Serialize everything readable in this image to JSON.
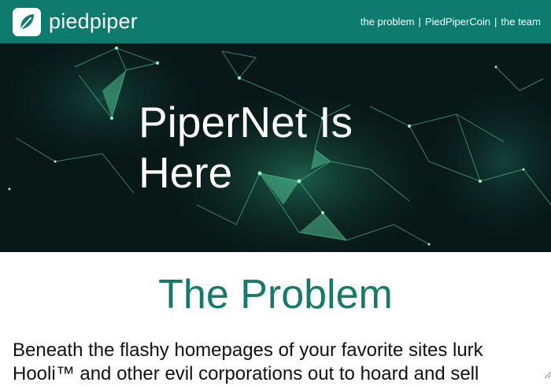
{
  "header": {
    "brand": "piedpiper",
    "nav": [
      {
        "label": "the problem"
      },
      {
        "label": "PiedPiperCoin"
      },
      {
        "label": "the team"
      }
    ],
    "separator": "|"
  },
  "hero": {
    "title": "PiperNet Is Here"
  },
  "problem_section": {
    "title": "The Problem",
    "body": "Beneath the flashy homepages of your favorite sites lurk Hooli™ and other evil corporations out to hoard and sell"
  },
  "colors": {
    "header_bg": "#0f7b6e",
    "accent": "#137a6c",
    "hero_bg": "#081817",
    "network_green": "#5cd9a6"
  },
  "icons": {
    "logo": "leaf-logo-icon"
  }
}
